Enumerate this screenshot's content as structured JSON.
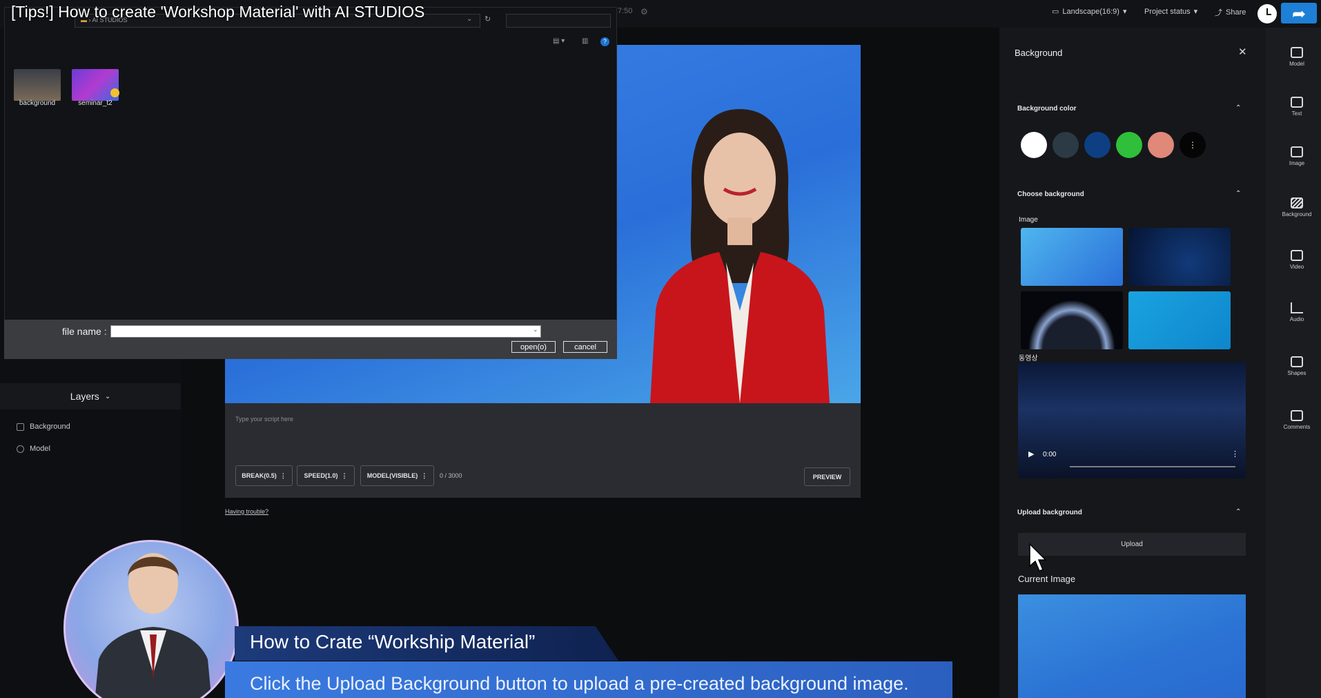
{
  "video_title": "[Tips!] How to create 'Workshop Material' with AI STUDIOS",
  "topbar": {
    "time": "7:50",
    "orientation": "Landscape(16:9)",
    "project_status": "Project status",
    "share": "Share"
  },
  "file_dialog": {
    "path": "AI STUDIOS",
    "items": [
      {
        "label": "background"
      },
      {
        "label": "seminar_t2"
      }
    ],
    "file_name_label": "file name :",
    "file_name_value": "",
    "open_label": "open(o)",
    "cancel_label": "cancel"
  },
  "layers": {
    "header": "Layers",
    "items": [
      {
        "label": "Background"
      },
      {
        "label": "Model"
      }
    ]
  },
  "script": {
    "placeholder": "Type your script here",
    "break_label": "BREAK(0.5)",
    "speed_label": "SPEED(1.0)",
    "model_label": "MODEL(VISIBLE)",
    "counter": "0 / 3000",
    "preview_label": "PREVIEW",
    "trouble_link": "Having trouble?"
  },
  "background_panel": {
    "title": "Background",
    "color_section": "Background color",
    "colors": [
      "#ffffff",
      "#2b3a44",
      "#0d3f82",
      "#2fbf3a",
      "#e0887a"
    ],
    "choose_section": "Choose background",
    "image_label": "Image",
    "video_label": "동영상",
    "video_time": "0:00",
    "upload_section": "Upload background",
    "upload_button": "Upload",
    "current_image_label": "Current Image"
  },
  "tools": [
    {
      "label": "Model",
      "icon": "model-icon"
    },
    {
      "label": "Text",
      "icon": "text-icon"
    },
    {
      "label": "Image",
      "icon": "image-icon"
    },
    {
      "label": "Background",
      "icon": "background-icon"
    },
    {
      "label": "Video",
      "icon": "video-icon"
    },
    {
      "label": "Audio",
      "icon": "audio-icon"
    },
    {
      "label": "Shapes",
      "icon": "shapes-icon"
    },
    {
      "label": "Comments",
      "icon": "comments-icon"
    }
  ],
  "overlay": {
    "heading": "How to Crate “Workship Material”",
    "caption": "Click the Upload Background button to upload a pre-created background image."
  }
}
